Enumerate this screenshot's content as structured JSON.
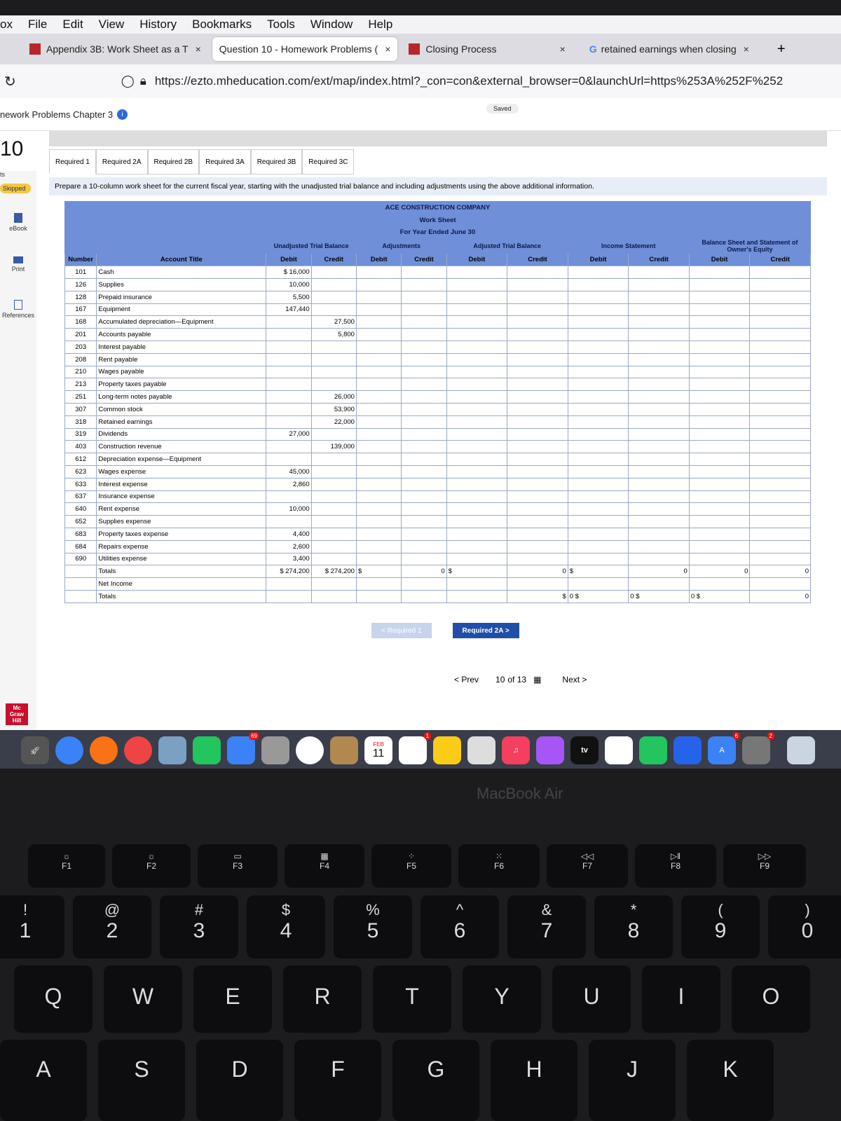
{
  "menu": [
    "File",
    "Edit",
    "View",
    "History",
    "Bookmarks",
    "Tools",
    "Window",
    "Help"
  ],
  "menu_lead": "ox",
  "tabs": [
    {
      "label": "Appendix 3B: Work Sheet as a T",
      "close": "×"
    },
    {
      "label": "Question 10 - Homework Problems (",
      "close": "×"
    },
    {
      "label": "Closing Process",
      "close": "×"
    },
    {
      "label": "retained earnings when closing",
      "close": "×"
    }
  ],
  "new_tab": "+",
  "url": "https://ezto.mheducation.com/ext/map/index.html?_con=con&external_browser=0&launchUrl=https%253A%252F%252",
  "app": {
    "title": "nework Problems Chapter 3",
    "saved": "Saved",
    "question_num": "10",
    "points_partial": "ts",
    "skipped": "Skipped"
  },
  "sidebar": [
    "eBook",
    "Print",
    "References"
  ],
  "req_tabs": [
    "Required 1",
    "Required 2A",
    "Required 2B",
    "Required 3A",
    "Required 3B",
    "Required 3C"
  ],
  "instruction": "Prepare a 10-column work sheet for the current fiscal year, starting with the unadjusted trial balance and including adjustments using the above additional information.",
  "sheet": {
    "company": "ACE CONSTRUCTION COMPANY",
    "title": "Work Sheet",
    "period": "For Year Ended June 30",
    "groups": [
      "Unadjusted Trial Balance",
      "Adjustments",
      "Adjusted Trial Balance",
      "Income Statement",
      "Balance Sheet and Statement of Owner's Equity"
    ],
    "cols": [
      "Number",
      "Account Title",
      "Debit",
      "Credit",
      "Debit",
      "Credit",
      "Debit",
      "Credit",
      "Debit",
      "Credit",
      "Debit",
      "Credit"
    ],
    "rows": [
      {
        "n": "101",
        "t": "Cash",
        "d": "$ 16,000",
        "c": ""
      },
      {
        "n": "126",
        "t": "Supplies",
        "d": "10,000",
        "c": ""
      },
      {
        "n": "128",
        "t": "Prepaid insurance",
        "d": "5,500",
        "c": ""
      },
      {
        "n": "167",
        "t": "Equipment",
        "d": "147,440",
        "c": ""
      },
      {
        "n": "168",
        "t": "Accumulated depreciation—Equipment",
        "d": "",
        "c": "27,500"
      },
      {
        "n": "201",
        "t": "Accounts payable",
        "d": "",
        "c": "5,800"
      },
      {
        "n": "203",
        "t": "Interest payable",
        "d": "",
        "c": ""
      },
      {
        "n": "208",
        "t": "Rent payable",
        "d": "",
        "c": ""
      },
      {
        "n": "210",
        "t": "Wages payable",
        "d": "",
        "c": ""
      },
      {
        "n": "213",
        "t": "Property taxes payable",
        "d": "",
        "c": ""
      },
      {
        "n": "251",
        "t": "Long-term notes payable",
        "d": "",
        "c": "26,000"
      },
      {
        "n": "307",
        "t": "Common stock",
        "d": "",
        "c": "53,900"
      },
      {
        "n": "318",
        "t": "Retained earnings",
        "d": "",
        "c": "22,000"
      },
      {
        "n": "319",
        "t": "Dividends",
        "d": "27,000",
        "c": ""
      },
      {
        "n": "403",
        "t": "Construction revenue",
        "d": "",
        "c": "139,000"
      },
      {
        "n": "612",
        "t": "Depreciation expense—Equipment",
        "d": "",
        "c": ""
      },
      {
        "n": "623",
        "t": "Wages expense",
        "d": "45,000",
        "c": ""
      },
      {
        "n": "633",
        "t": "Interest expense",
        "d": "2,860",
        "c": ""
      },
      {
        "n": "637",
        "t": "Insurance expense",
        "d": "",
        "c": ""
      },
      {
        "n": "640",
        "t": "Rent expense",
        "d": "10,000",
        "c": ""
      },
      {
        "n": "652",
        "t": "Supplies expense",
        "d": "",
        "c": ""
      },
      {
        "n": "683",
        "t": "Property taxes expense",
        "d": "4,400",
        "c": ""
      },
      {
        "n": "684",
        "t": "Repairs expense",
        "d": "2,600",
        "c": ""
      },
      {
        "n": "690",
        "t": "Utilities expense",
        "d": "3,400",
        "c": ""
      }
    ],
    "totals_row": {
      "t": "Totals",
      "d": "$ 274,200",
      "c": "$ 274,200",
      "rest": [
        "$",
        "0",
        "$",
        "0",
        "$",
        "0",
        "$",
        "0",
        "0",
        "0",
        "0"
      ]
    },
    "net_income": "Net Income",
    "totals2": "Totals",
    "totals2_rest": [
      "$",
      "0",
      "$",
      "0",
      "$",
      "0",
      "$",
      "0"
    ]
  },
  "buttons": {
    "prev_req": "< Required 1",
    "next_req": "Required 2A  >"
  },
  "pager": {
    "prev": "< Prev",
    "pos": "10",
    "of": "of 13",
    "next": "Next >"
  },
  "logo": "Mc Graw Hill",
  "dock_labels": {
    "calendar_month": "FEB",
    "calendar_day": "11",
    "tv": "tv",
    "badge1": "69",
    "badge2": "1",
    "badge3": "6",
    "badge4": "2"
  },
  "laptop": "MacBook Air",
  "fkeys": [
    "F1",
    "F2",
    "F3",
    "F4",
    "F5",
    "F6",
    "F7",
    "F8",
    "F9"
  ],
  "numkeys": [
    {
      "s": "!",
      "m": "1"
    },
    {
      "s": "@",
      "m": "2"
    },
    {
      "s": "#",
      "m": "3"
    },
    {
      "s": "$",
      "m": "4"
    },
    {
      "s": "%",
      "m": "5"
    },
    {
      "s": "^",
      "m": "6"
    },
    {
      "s": "&",
      "m": "7"
    },
    {
      "s": "*",
      "m": "8"
    },
    {
      "s": "(",
      "m": "9"
    },
    {
      "s": ")",
      "m": "0"
    }
  ],
  "qrow": [
    "Q",
    "W",
    "E",
    "R",
    "T",
    "Y",
    "U",
    "I",
    "O"
  ],
  "arow": [
    "A",
    "S",
    "D",
    "F",
    "G",
    "H",
    "J",
    "K"
  ]
}
